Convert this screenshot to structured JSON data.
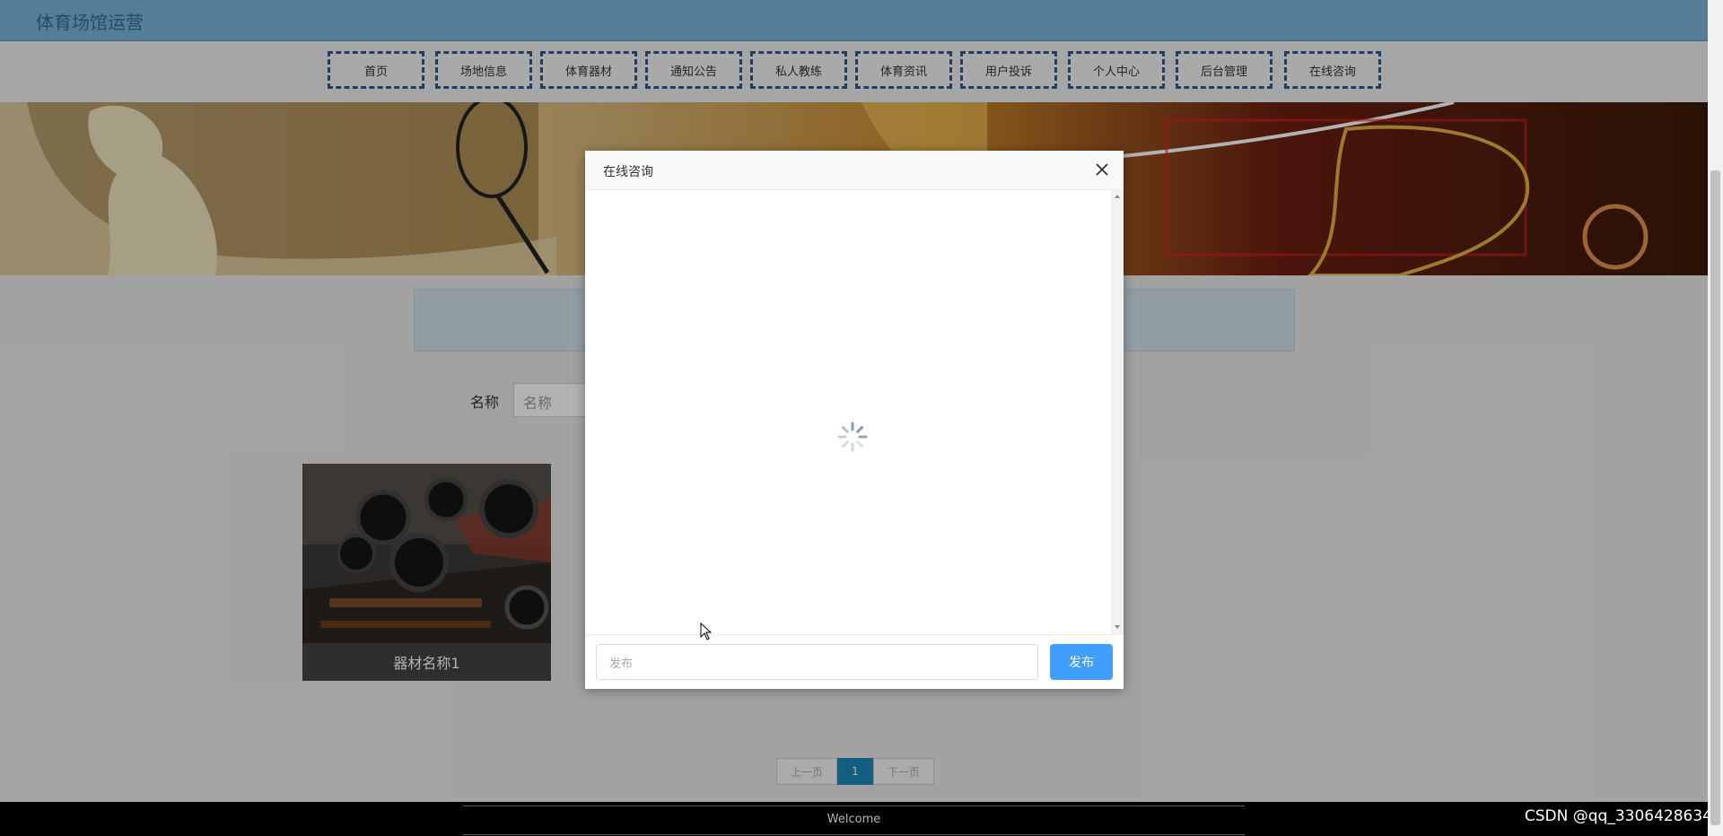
{
  "header": {
    "site_title": "体育场馆运营"
  },
  "nav": {
    "items": [
      {
        "label": "首页"
      },
      {
        "label": "场地信息"
      },
      {
        "label": "体育器材"
      },
      {
        "label": "通知公告"
      },
      {
        "label": "私人教练"
      },
      {
        "label": "体育资讯"
      },
      {
        "label": "用户投诉"
      },
      {
        "label": "个人中心"
      },
      {
        "label": "后台管理"
      },
      {
        "label": "在线咨询"
      }
    ]
  },
  "search": {
    "label": "名称",
    "placeholder": "名称"
  },
  "cards": [
    {
      "caption": "器材名称1"
    }
  ],
  "pagination": {
    "prev": "上一页",
    "current": "1",
    "next": "下一页"
  },
  "footer": {
    "text": "Welcome"
  },
  "watermark": "CSDN @qq_3306428634",
  "modal": {
    "title": "在线咨询",
    "input_placeholder": "发布",
    "send_label": "发布"
  },
  "colors": {
    "accent": "#409eff",
    "topbar": "#7ab4d6",
    "nav_border": "#2f5a8c",
    "page_active": "#1e87b6"
  }
}
